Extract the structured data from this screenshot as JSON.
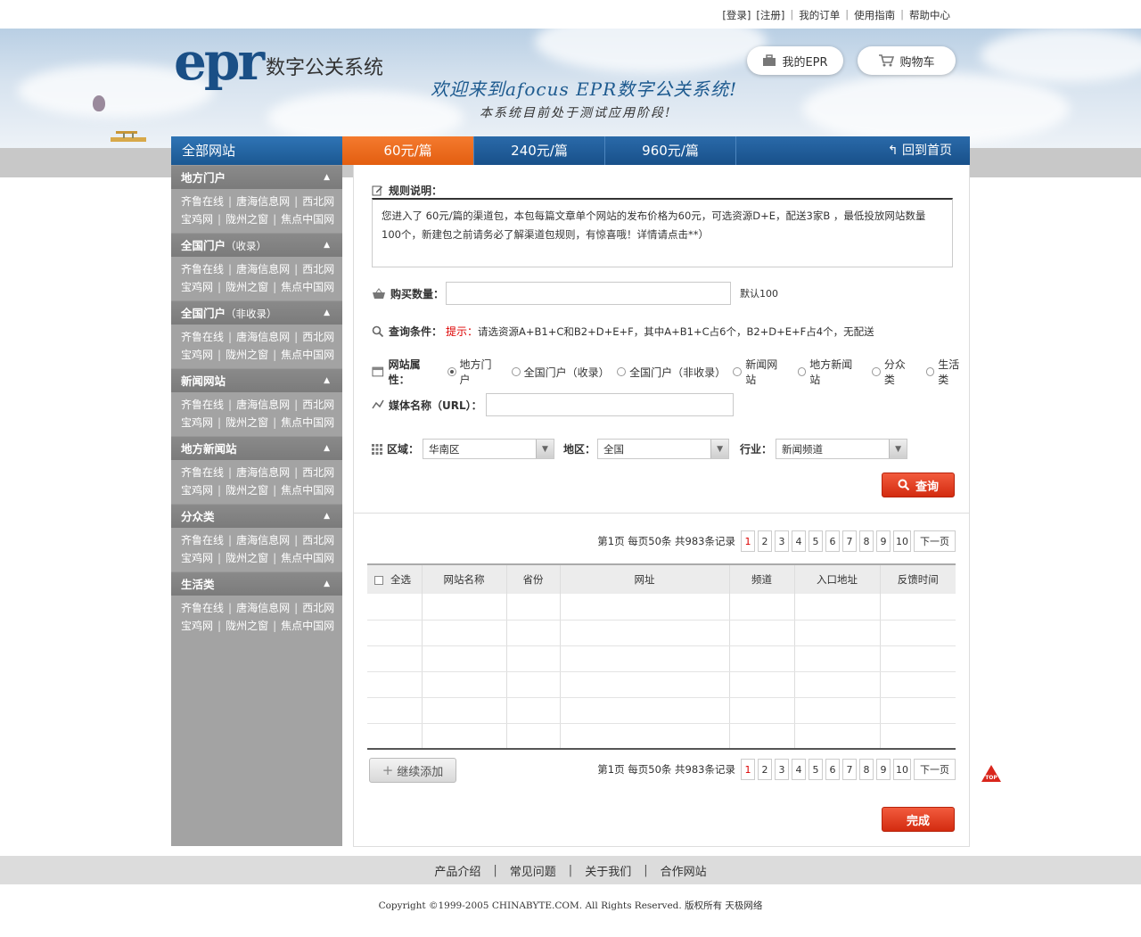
{
  "top_links": [
    "[登录]",
    "[注册]",
    "我的订单",
    "使用指南",
    "帮助中心"
  ],
  "logo": {
    "mark": "epr",
    "text": "数字公关系统"
  },
  "banner": {
    "welcome": "欢迎来到afocus EPR数字公关系统!",
    "testing": "本系统目前处于测试应用阶段!",
    "my_epr": "我的EPR",
    "cart": "购物车"
  },
  "nav": {
    "all_sites": "全部网站",
    "tabs": [
      "60元/篇",
      "240元/篇",
      "960元/篇"
    ],
    "home": "回到首页"
  },
  "sidebar": [
    {
      "title": "地方门户",
      "sub": "",
      "row1": [
        "齐鲁在线",
        "唐海信息网",
        "西北网"
      ],
      "row2": [
        "宝鸡网",
        "陇州之窗",
        "焦点中国网"
      ]
    },
    {
      "title": "全国门户",
      "sub": "（收录）",
      "row1": [
        "齐鲁在线",
        "唐海信息网",
        "西北网"
      ],
      "row2": [
        "宝鸡网",
        "陇州之窗",
        "焦点中国网"
      ]
    },
    {
      "title": "全国门户",
      "sub": "（非收录）",
      "row1": [
        "齐鲁在线",
        "唐海信息网",
        "西北网"
      ],
      "row2": [
        "宝鸡网",
        "陇州之窗",
        "焦点中国网"
      ]
    },
    {
      "title": "新闻网站",
      "sub": "",
      "row1": [
        "齐鲁在线",
        "唐海信息网",
        "西北网"
      ],
      "row2": [
        "宝鸡网",
        "陇州之窗",
        "焦点中国网"
      ]
    },
    {
      "title": "地方新闻站",
      "sub": "",
      "row1": [
        "齐鲁在线",
        "唐海信息网",
        "西北网"
      ],
      "row2": [
        "宝鸡网",
        "陇州之窗",
        "焦点中国网"
      ]
    },
    {
      "title": "分众类",
      "sub": "",
      "row1": [
        "齐鲁在线",
        "唐海信息网",
        "西北网"
      ],
      "row2": [
        "宝鸡网",
        "陇州之窗",
        "焦点中国网"
      ]
    },
    {
      "title": "生活类",
      "sub": "",
      "row1": [
        "齐鲁在线",
        "唐海信息网",
        "西北网"
      ],
      "row2": [
        "宝鸡网",
        "陇州之窗",
        "焦点中国网"
      ]
    }
  ],
  "rules": {
    "title": "规则说明：",
    "text": "您进入了 60元/篇的渠道包，本包每篇文章单个网站的发布价格为60元，可选资源D+E，配送3家B ，最低投放网站数量100个，新建包之前请务必了解渠道包规则，有惊喜哦！详情请点击**）"
  },
  "form": {
    "qty_label": "购买数量：",
    "qty_value": "",
    "qty_default": "默认100",
    "query_label": "查询条件：",
    "hint_label": "提示：",
    "hint_text": "请选资源A+B1+C和B2+D+E+F，其中A+B1+C占6个，B2+D+E+F占4个，无配送",
    "nature_label": "网站属性：",
    "natures": [
      "地方门户",
      "全国门户（收录）",
      "全国门户（非收录）",
      "新闻网站",
      "地方新闻站",
      "分众类",
      "生活类"
    ],
    "nature_selected": "地方门户",
    "media_label": "媒体名称（URL）：",
    "media_value": "",
    "region_label": "区域：",
    "region_value": "华南区",
    "area_label": "地区：",
    "area_value": "全国",
    "industry_label": "行业：",
    "industry_value": "新闻频道",
    "query_button": "查询"
  },
  "pager": {
    "info": "第1页 每页50条 共983条记录",
    "pages": [
      "1",
      "2",
      "3",
      "4",
      "5",
      "6",
      "7",
      "8",
      "9",
      "10"
    ],
    "current": "1",
    "next": "下一页"
  },
  "table": {
    "select_all": "全选",
    "columns": [
      "网站名称",
      "省份",
      "网址",
      "频道",
      "入口地址",
      "反馈时间"
    ],
    "rows": 6
  },
  "buttons": {
    "add_more": "继续添加",
    "done": "完成",
    "top": "TOP"
  },
  "footer": {
    "links": [
      "产品介绍",
      "常见问题",
      "关于我们",
      "合作网站"
    ],
    "copyright": "Copyright ©1999-2005 CHINABYTE.COM. All Rights Reserved. 版权所有 天极网络"
  },
  "colors": {
    "nav_blue": "#1e5d9b",
    "active_orange": "#e96a1e",
    "sidebar_gray": "#a3a3a3",
    "button_red": "#d93a1c",
    "hint_red": "#d00000"
  }
}
